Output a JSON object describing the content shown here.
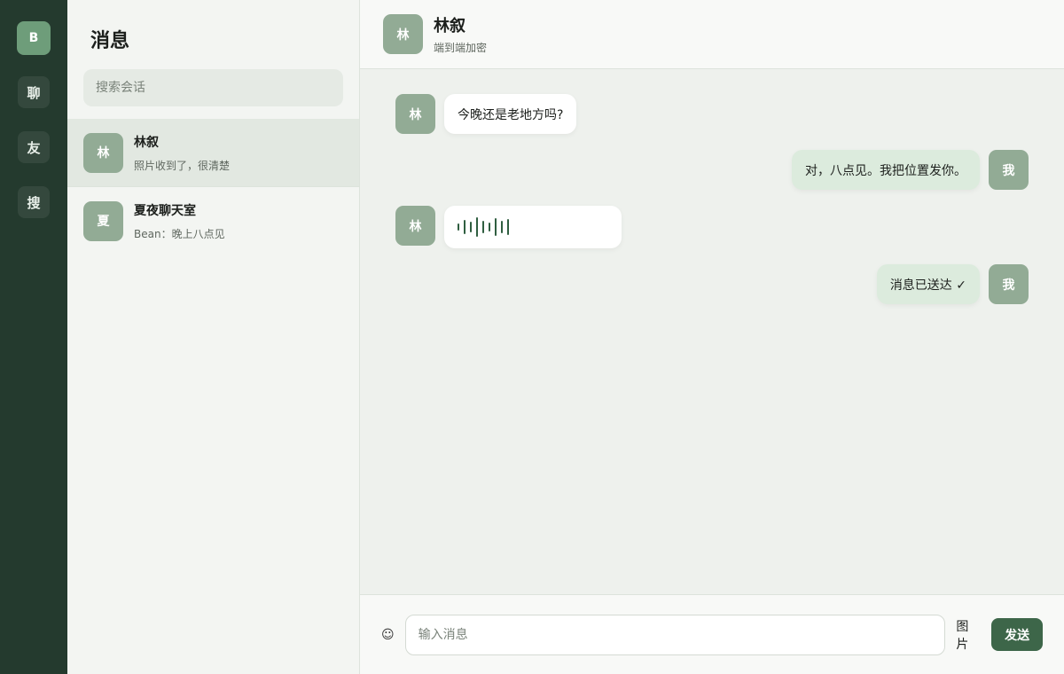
{
  "rail": {
    "me": "B",
    "items": [
      {
        "label": "聊"
      },
      {
        "label": "友"
      },
      {
        "label": "搜"
      }
    ]
  },
  "sidebar": {
    "title": "消息",
    "search_placeholder": "搜索会话",
    "conversations": [
      {
        "avatar": "林",
        "name": "林叙",
        "preview": "照片收到了，很清楚",
        "active": true
      },
      {
        "avatar": "夏",
        "name": "夏夜聊天室",
        "preview": "Bean：晚上八点见",
        "active": false
      }
    ]
  },
  "chat": {
    "avatar": "林",
    "name": "林叙",
    "subtitle": "端到端加密",
    "messages": [
      {
        "dir": "in",
        "avatar": "林",
        "text": "今晚还是老地方吗?"
      },
      {
        "dir": "out",
        "avatar": "我",
        "text": "对，八点见。我把位置发你。"
      },
      {
        "dir": "in",
        "avatar": "林",
        "type": "voice"
      },
      {
        "dir": "out",
        "avatar": "我",
        "text": "消息已送达 ✓"
      }
    ]
  },
  "composer": {
    "emoji": "☺",
    "placeholder": "输入消息",
    "image_label": "图片",
    "send_label": "发送"
  },
  "colors": {
    "rail_bg": "#243a2e",
    "accent": "#3d6649",
    "avatar_bg": "#92ab95",
    "out_bubble": "#dcebdd"
  }
}
